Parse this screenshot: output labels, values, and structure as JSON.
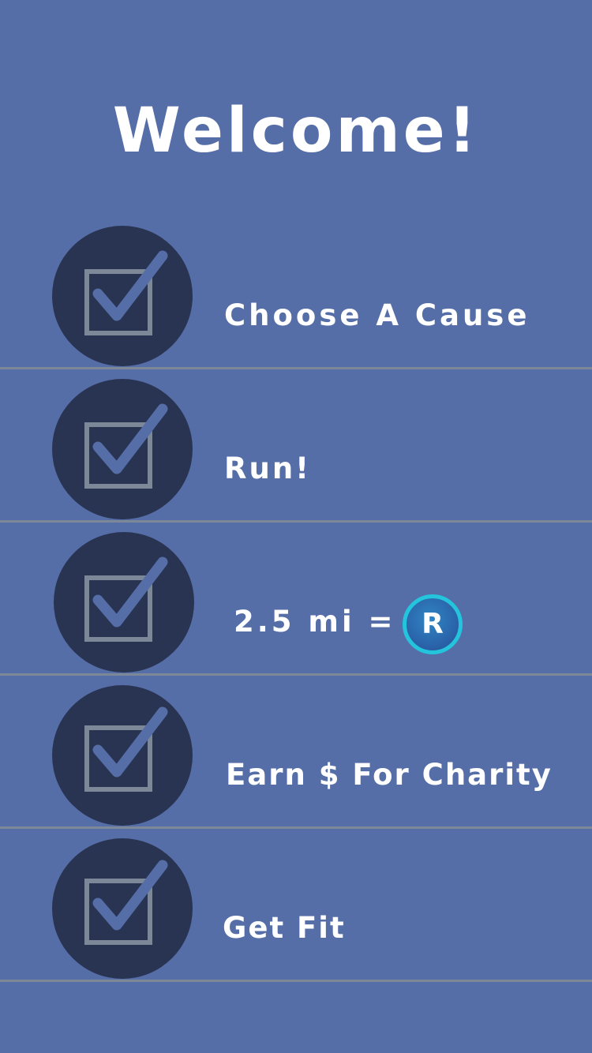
{
  "header": {
    "title": "Welcome!"
  },
  "steps": [
    {
      "label": "Choose A Cause",
      "icon": "checkbox-checked-icon"
    },
    {
      "label": "Run!",
      "icon": "checkbox-checked-icon"
    },
    {
      "label": "2.5 mi =",
      "icon": "checkbox-checked-icon",
      "badge": "R",
      "badge_icon": "coin-icon"
    },
    {
      "label": "Earn $ For Charity",
      "icon": "checkbox-checked-icon"
    },
    {
      "label": "Get Fit",
      "icon": "checkbox-checked-icon"
    }
  ],
  "colors": {
    "background": "#566ea8",
    "circle": "#293452",
    "checkbox_outline": "#7c8898",
    "checkmark": "#566ea8",
    "divider": "#7c8898",
    "coin_ring": "#23c4dc",
    "text": "#ffffff"
  }
}
